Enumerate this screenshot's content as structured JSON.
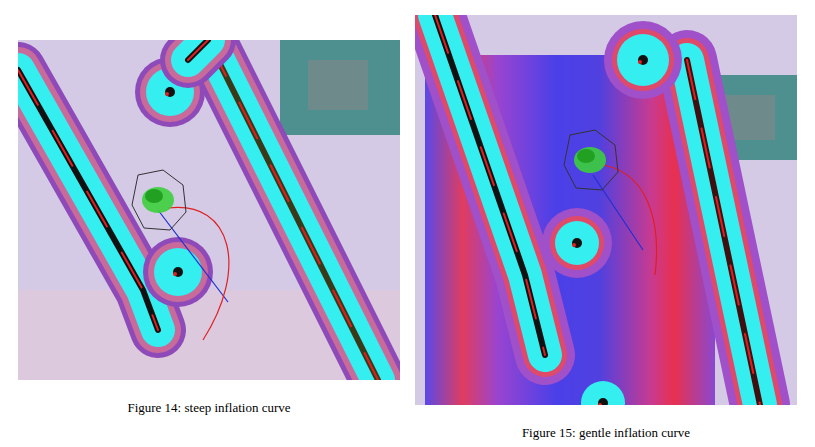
{
  "figures": [
    {
      "kind": "steep",
      "caption": "Figure 14: steep inflation curve"
    },
    {
      "kind": "gentle",
      "caption": "Figure 15: gentle inflation curve"
    }
  ]
}
